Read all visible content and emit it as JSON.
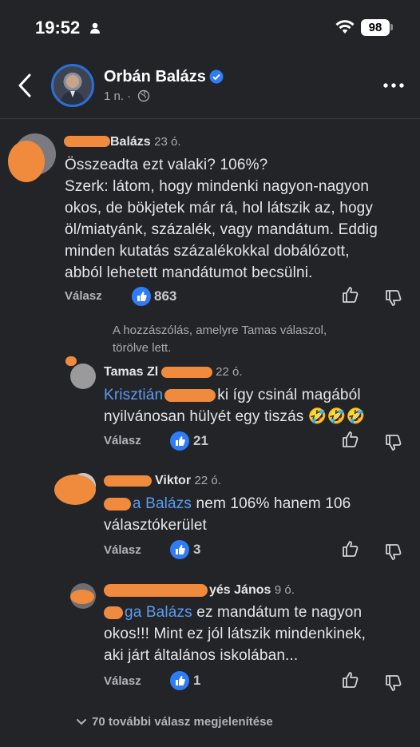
{
  "status_bar": {
    "time": "19:52",
    "battery": "98"
  },
  "header": {
    "page_name": "Orbán Balázs",
    "post_age": "1 n. ·"
  },
  "comments": [
    {
      "name": "Balázs",
      "age": "23 ó.",
      "text_lines": [
        "Összeadta ezt valaki? 106%?",
        "Szerk: látom, hogy mindenki nagyon-nagyon",
        "okos, de bökjetek már rá, hol látszik az, hogy",
        "öl/miatyánk, százalék, vagy mandátum. Eddig",
        "minden kutatás százalékokkal dobálózott,",
        "abból lehetett mandátumot becsülni."
      ],
      "reply_label": "Válasz",
      "likes": "863"
    }
  ],
  "deleted_notice_lines": [
    "A hozzászólás, amelyre Tamas válaszol,",
    "törölve lett."
  ],
  "replies": [
    {
      "name": "Tamas Zl",
      "age": "22 ó.",
      "mention": "Krisztián",
      "line1_rest": "ki így csinál magából",
      "line2": "nyilvánosan hülyét egy tiszás 🤣🤣🤣",
      "reply_label": "Válasz",
      "likes": "21"
    },
    {
      "name": "Viktor",
      "age": "22 ó.",
      "mention": "a Balázs",
      "line1_rest": "nem 106% hanem 106",
      "line2": "választókerület",
      "reply_label": "Válasz",
      "likes": "3"
    },
    {
      "name": "yés János",
      "age": "9 ó.",
      "mention": "ga Balázs",
      "line1_rest": "ez mandátum te nagyon",
      "line2": "okos!!! Mint ez jól látszik mindenkinek,",
      "line3": "aki járt általános iskolában...",
      "reply_label": "Válasz",
      "likes": "1"
    }
  ],
  "more_replies": "70 további válasz megjelenítése",
  "icons": [
    "person-icon",
    "wifi-icon",
    "back-icon",
    "verified-icon",
    "globe-icon",
    "more-icon",
    "like-icon",
    "dislike-icon",
    "chevron-down-icon"
  ],
  "colors": {
    "background": "#232427",
    "link": "#5b9bf0",
    "like_badge": "#2e7cf6",
    "scribble": "#f08a3c"
  }
}
